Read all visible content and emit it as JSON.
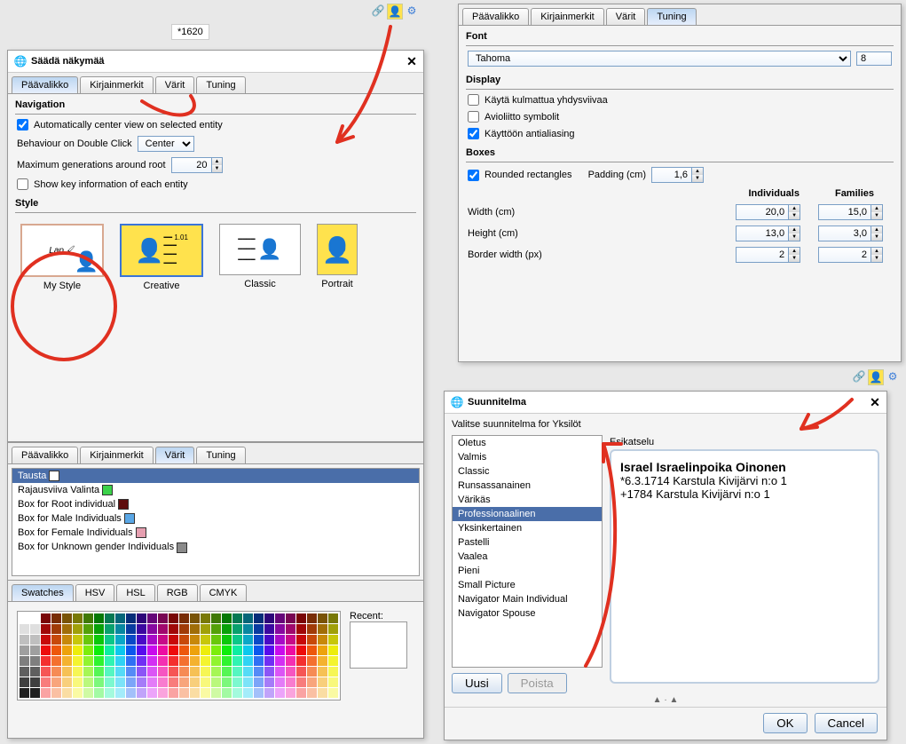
{
  "doc_tab": "*1620",
  "tooltip_title": "Säädä näkymää",
  "tabs": [
    "Päävalikko",
    "Kirjainmerkit",
    "Värit",
    "Tuning"
  ],
  "navigation": {
    "heading": "Navigation",
    "auto_center_label": "Automatically center view on selected entity",
    "behaviour_label": "Behaviour on Double Click",
    "behaviour_value": "Center",
    "maxgen_label": "Maximum generations around root",
    "maxgen_value": "20",
    "showkey_label": "Show key information of each entity"
  },
  "style": {
    "heading": "Style",
    "items": [
      "My Style",
      "Creative",
      "Classic",
      "Portrait"
    ]
  },
  "colors_panel": {
    "heading": "Tausta",
    "rows": [
      {
        "label": "Rajausviiva Valinta",
        "color": "#3bd24a"
      },
      {
        "label": "Box for Root individual",
        "color": "#5e0d0d"
      },
      {
        "label": "Box for Male Individuals",
        "color": "#5aa7e6"
      },
      {
        "label": "Box for Female Individuals",
        "color": "#e69fb0"
      },
      {
        "label": "Box for Unknown gender Individuals",
        "color": "#8a8a8a"
      }
    ],
    "tabs": [
      "Swatches",
      "HSV",
      "HSL",
      "RGB",
      "CMYK"
    ],
    "recent_label": "Recent:"
  },
  "tuning_panel": {
    "font_heading": "Font",
    "font_value": "Tahoma",
    "font_size": "8",
    "display_heading": "Display",
    "cb1": "Käytä kulmattua yhdysviivaa",
    "cb2": "Avioliitto symbolit",
    "cb3": "Käyttöön antialiasing",
    "boxes_heading": "Boxes",
    "rounded_label": "Rounded rectangles",
    "padding_label": "Padding (cm)",
    "padding_value": "1,6",
    "col_ind": "Individuals",
    "col_fam": "Families",
    "width_label": "Width (cm)",
    "width_ind": "20,0",
    "width_fam": "15,0",
    "height_label": "Height (cm)",
    "height_ind": "13,0",
    "height_fam": "3,0",
    "border_label": "Border width (px)",
    "border_ind": "2",
    "border_fam": "2"
  },
  "plan_dialog": {
    "title": "Suunnitelma",
    "prompt": "Valitse suunnitelma for Yksilöt",
    "items": [
      "Oletus",
      "Valmis",
      "Classic",
      "Runsassanainen",
      "Värikäs",
      "Professionaalinen",
      "Yksinkertainen",
      "Pastelli",
      "Vaalea",
      "Pieni",
      "Small Picture",
      "Navigator Main Individual",
      "Navigator Spouse"
    ],
    "selected_index": 5,
    "new_btn": "Uusi",
    "delete_btn": "Poista",
    "preview_heading": "Esikatselu",
    "preview_name": "Israel Israelinpoika Oinonen",
    "preview_birth": "*6.3.1714  Karstula Kivijärvi n:o 1",
    "preview_death": "+1784  Karstula Kivijärvi n:o 1",
    "ok": "OK",
    "cancel": "Cancel"
  }
}
